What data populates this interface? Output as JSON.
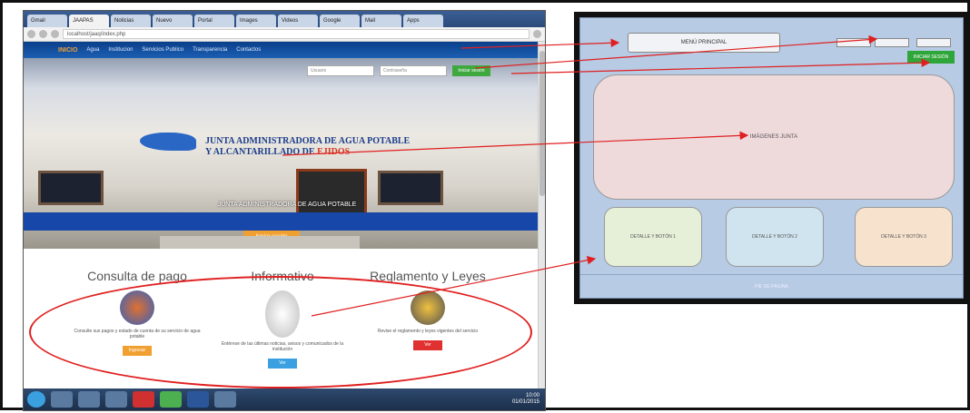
{
  "browser": {
    "tabs": [
      "Gmail",
      "JAAPAS",
      "Noticias",
      "Nuevo",
      "Portal",
      "Images",
      "Videos",
      "Google",
      "Mail",
      "Apps"
    ],
    "url": "localhost/jaaq/index.php"
  },
  "site": {
    "nav": [
      "INICIO",
      "Agua",
      "Institucion",
      "Servicios Publico",
      "Transparencia",
      "Contactos"
    ],
    "login": {
      "user_placeholder": "Usuario",
      "pass_placeholder": "Contraseña",
      "button": "Iniciar sesión"
    },
    "banner_line1": "JUNTA ADMINISTRADORA DE AGUA POTABLE",
    "banner_line2": "Y ALCANTARILLADO DE",
    "banner_place": "EJIDOS",
    "overlay_text": "JUNTA ADMINISTRADORA DE AGUA POTABLE",
    "hero_button": "Iniciar sesión"
  },
  "cards": [
    {
      "title": "Consulta de pago",
      "text": "Consulte sus pagos y estado de cuenta de su servicio de agua potable",
      "button": "Ingresar",
      "color": "#f0a030"
    },
    {
      "title": "Informativo",
      "text": "Entérese de las últimas noticias, avisos y comunicados de la institución",
      "button": "Ver",
      "color": "#3aa0e0"
    },
    {
      "title": "Reglamento y Leyes",
      "text": "Revise el reglamento y leyes vigentes del servicio",
      "button": "Ver",
      "color": "#e03030"
    }
  ],
  "taskbar": {
    "time": "10:00",
    "date": "01/01/2015"
  },
  "mockup": {
    "menu": "MENÚ PRINCIPAL",
    "login_button": "INICIAR SESIÓN",
    "image": "IMÁGENES JUNTA",
    "details": [
      "DETALLE Y BOTÓN 1",
      "DETALLE Y BOTÓN 2",
      "DETALLE Y BOTÓN 3"
    ],
    "footer": "PIE DE PÁGINA"
  },
  "colors": {
    "arrow": "#e02020",
    "mock_bg": "#b7cbe4",
    "login_green": "#2fa63a"
  }
}
